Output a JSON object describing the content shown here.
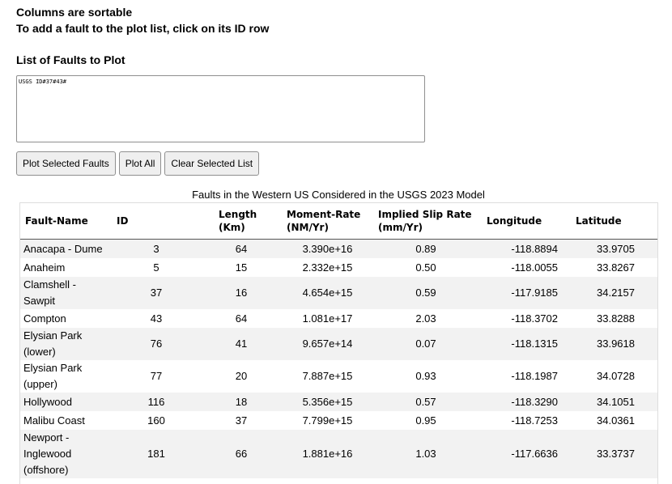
{
  "instructions": {
    "line1": "Columns are sortable",
    "line2": "To add a fault to the plot list, click on its ID row"
  },
  "plot_list": {
    "title": "List of Faults to Plot",
    "value": "USGS ID#37#43#"
  },
  "buttons": {
    "plot_selected": "Plot Selected Faults",
    "plot_all": "Plot All",
    "clear_list": "Clear Selected List"
  },
  "table": {
    "caption": "Faults in the Western US Considered in the USGS 2023 Model",
    "headers": [
      "Fault-Name",
      "ID",
      "Length (Km)",
      "Moment-Rate (NM/Yr)",
      "Implied Slip Rate (mm/Yr)",
      "Longitude",
      "Latitude"
    ],
    "rows": [
      {
        "name": "Anacapa - Dume",
        "id": "3",
        "length": "64",
        "moment": "3.390e+16",
        "slip": "0.89",
        "lon": "-118.8894",
        "lat": "33.9705"
      },
      {
        "name": "Anaheim",
        "id": "5",
        "length": "15",
        "moment": "2.332e+15",
        "slip": "0.50",
        "lon": "-118.0055",
        "lat": "33.8267"
      },
      {
        "name": "Clamshell - Sawpit",
        "id": "37",
        "length": "16",
        "moment": "4.654e+15",
        "slip": "0.59",
        "lon": "-117.9185",
        "lat": "34.2157"
      },
      {
        "name": "Compton",
        "id": "43",
        "length": "64",
        "moment": "1.081e+17",
        "slip": "2.03",
        "lon": "-118.3702",
        "lat": "33.8288"
      },
      {
        "name": "Elysian Park (lower)",
        "id": "76",
        "length": "41",
        "moment": "9.657e+14",
        "slip": "0.07",
        "lon": "-118.1315",
        "lat": "33.9618"
      },
      {
        "name": "Elysian Park (upper)",
        "id": "77",
        "length": "20",
        "moment": "7.887e+15",
        "slip": "0.93",
        "lon": "-118.1987",
        "lat": "34.0728"
      },
      {
        "name": "Hollywood",
        "id": "116",
        "length": "18",
        "moment": "5.356e+15",
        "slip": "0.57",
        "lon": "-118.3290",
        "lat": "34.1051"
      },
      {
        "name": "Malibu Coast",
        "id": "160",
        "length": "37",
        "moment": "7.799e+15",
        "slip": "0.95",
        "lon": "-118.7253",
        "lat": "34.0361"
      },
      {
        "name": "Newport - Inglewood (offshore)",
        "id": "181",
        "length": "66",
        "moment": "1.881e+16",
        "slip": "1.03",
        "lon": "-117.6636",
        "lat": "33.3737"
      }
    ]
  }
}
